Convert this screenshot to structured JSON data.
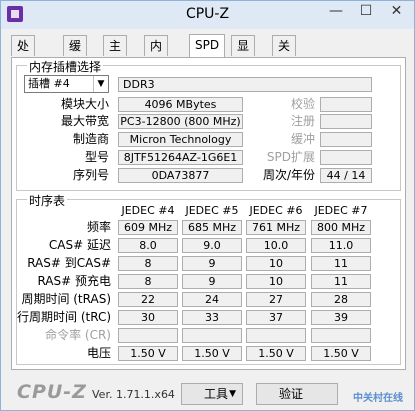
{
  "window": {
    "title": "CPU-Z",
    "min": "—",
    "max": "☐",
    "close": "✕"
  },
  "tabs": [
    "处理器",
    "缓存",
    "主板",
    "内存",
    "SPD",
    "显卡",
    "关于"
  ],
  "slot_group": {
    "title": "内存插槽选择",
    "slot_select": "插槽 #4",
    "type": "DDR3",
    "module_size_label": "模块大小",
    "module_size": "4096 MBytes",
    "max_bandwidth_label": "最大带宽",
    "max_bandwidth": "PC3-12800 (800 MHz)",
    "manufacturer_label": "制造商",
    "manufacturer": "Micron Technology",
    "part_label": "型号",
    "part_number": "8JTF51264AZ-1G6E1",
    "serial_label": "序列号",
    "serial": "0DA73877",
    "correction_label": "校验",
    "registered_label": "注册",
    "buffered_label": "缓冲",
    "spd_ext_label": "SPD扩展",
    "week_year_label": "周次/年份",
    "week_year": "44 / 14"
  },
  "timing_group": {
    "title": "时序表",
    "columns": [
      "JEDEC #4",
      "JEDEC #5",
      "JEDEC #6",
      "JEDEC #7"
    ],
    "rows": [
      {
        "label": "频率",
        "values": [
          "609 MHz",
          "685 MHz",
          "761 MHz",
          "800 MHz"
        ],
        "disabled": false
      },
      {
        "label": "CAS# 延迟",
        "values": [
          "8.0",
          "9.0",
          "10.0",
          "11.0"
        ],
        "disabled": false
      },
      {
        "label": "RAS# 到CAS#",
        "values": [
          "8",
          "9",
          "10",
          "11"
        ],
        "disabled": false
      },
      {
        "label": "RAS# 预充电",
        "values": [
          "8",
          "9",
          "10",
          "11"
        ],
        "disabled": false
      },
      {
        "label": "周期时间 (tRAS)",
        "values": [
          "22",
          "24",
          "27",
          "28"
        ],
        "disabled": false
      },
      {
        "label": "行周期时间 (tRC)",
        "values": [
          "30",
          "33",
          "37",
          "39"
        ],
        "disabled": false
      },
      {
        "label": "命令率 (CR)",
        "values": [
          "",
          "",
          "",
          ""
        ],
        "disabled": true
      },
      {
        "label": "电压",
        "values": [
          "1.50 V",
          "1.50 V",
          "1.50 V",
          "1.50 V"
        ],
        "disabled": false
      }
    ]
  },
  "footer": {
    "logo": "CPU-Z",
    "version": "Ver. 1.71.1.x64",
    "tools_button": "工具",
    "validate_button": "验证",
    "watermark": "中关村在线"
  }
}
